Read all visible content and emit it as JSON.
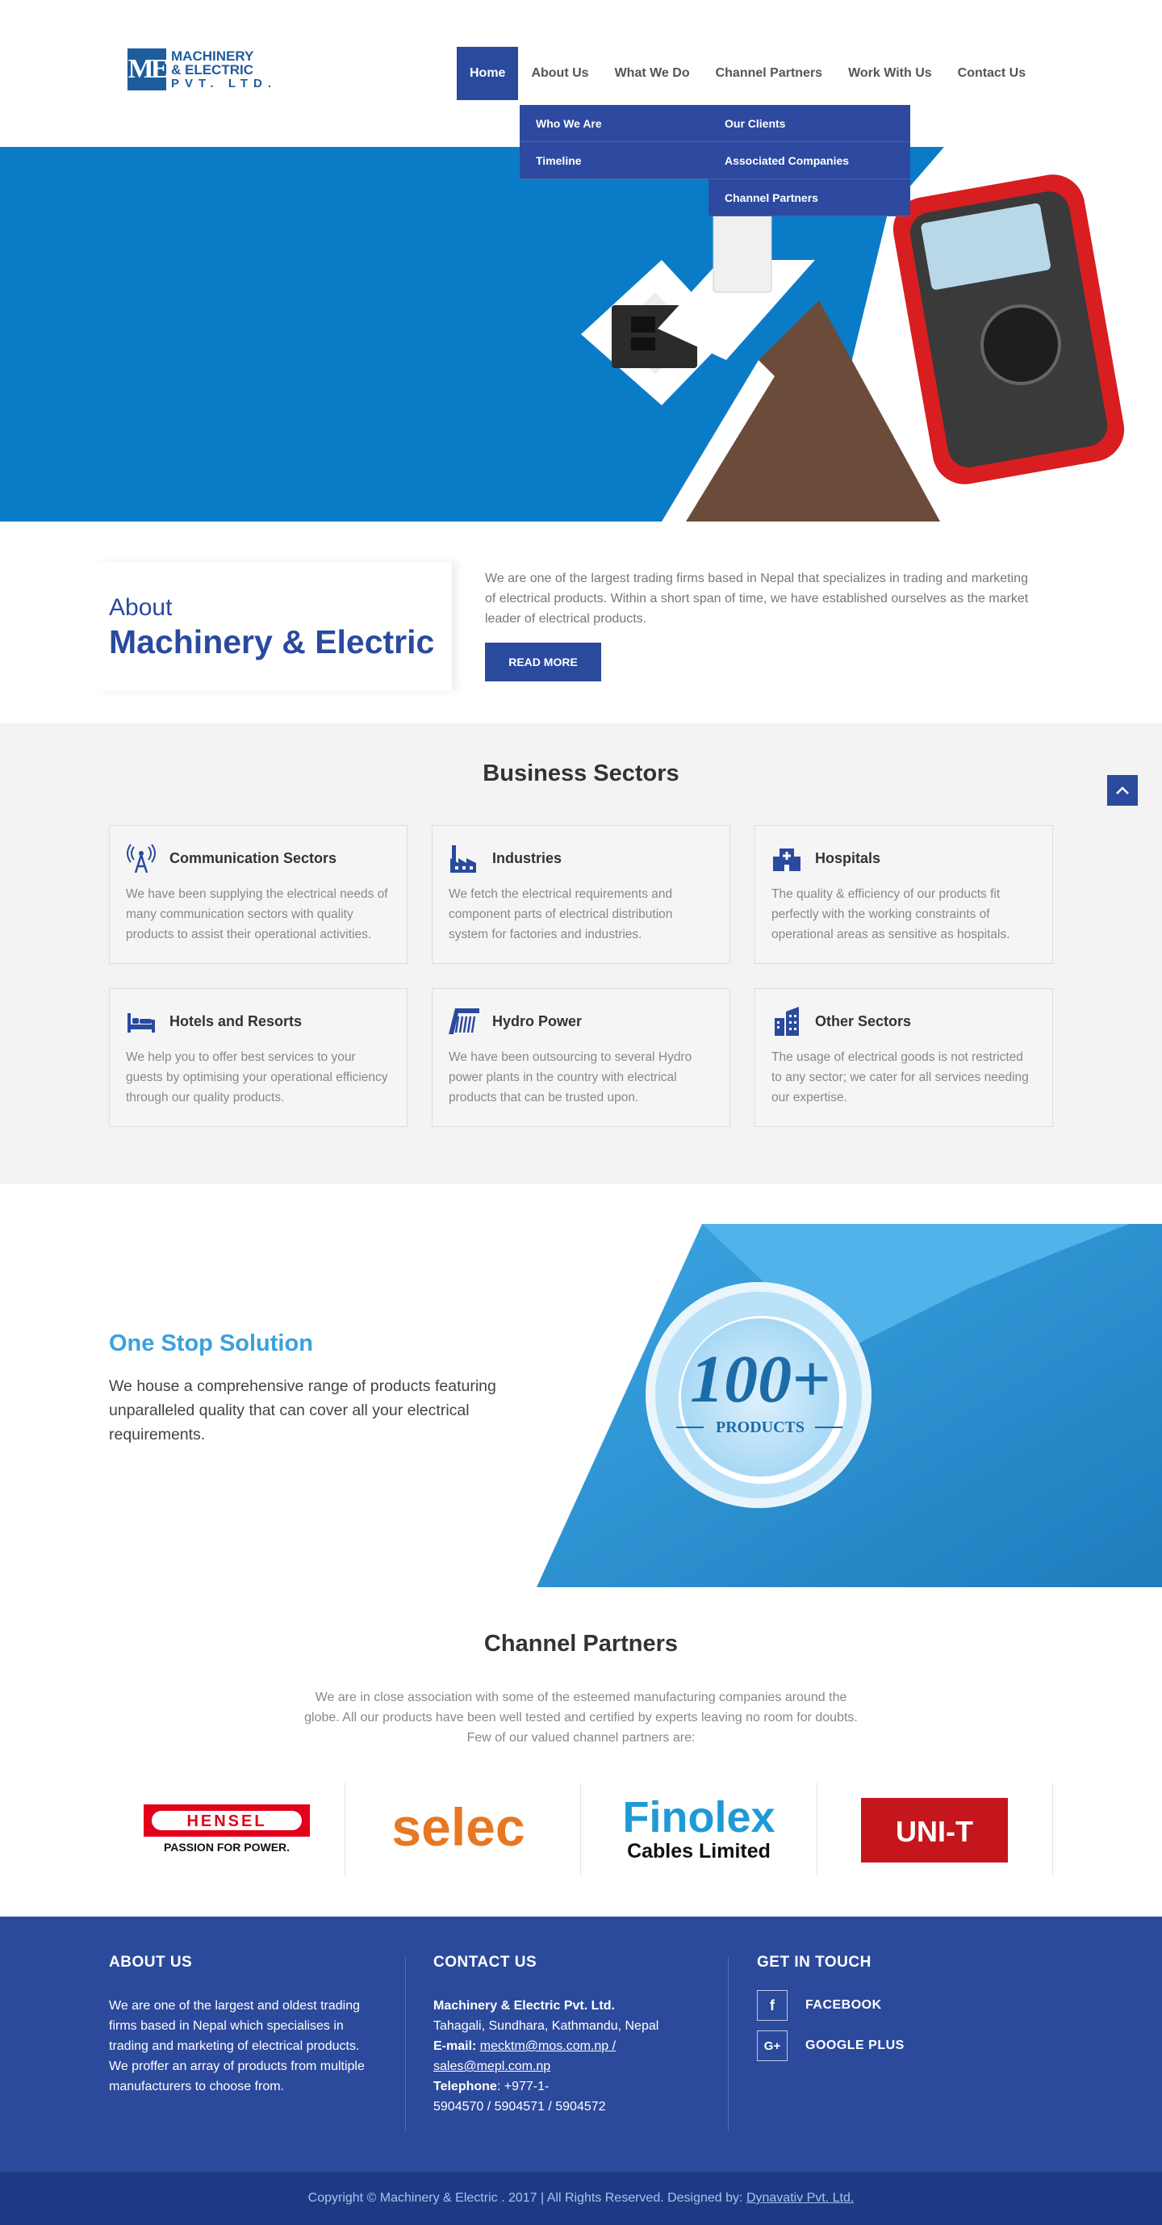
{
  "header": {
    "logo": {
      "mark": "ME",
      "line1": "MACHINERY",
      "line2": "& ELECTRIC",
      "line3": "PVT. LTD."
    },
    "nav": [
      "Home",
      "About Us",
      "What We Do",
      "Channel Partners",
      "Work With Us",
      "Contact Us"
    ],
    "about_menu": [
      "Who We Are",
      "Timeline"
    ],
    "channel_menu": [
      "Our Clients",
      "Associated Companies",
      "Channel Partners"
    ]
  },
  "about": {
    "small": "About",
    "big": "Machinery & Electric",
    "text": "We are one of the largest trading firms based in Nepal that specializes in trading and marketing of electrical products. Within a short span of time, we have established ourselves as the market leader of electrical products.",
    "button": "READ MORE"
  },
  "sectors": {
    "title": "Business Sectors",
    "items": [
      {
        "title": "Communication Sectors",
        "icon": "antenna-icon",
        "text": "We have been supplying the electrical needs of many communication sectors with quality products to assist their operational activities."
      },
      {
        "title": "Industries",
        "icon": "factory-icon",
        "text": "We fetch the electrical requirements and component parts of electrical distribution system for factories and industries."
      },
      {
        "title": "Hospitals",
        "icon": "hospital-icon",
        "text": "The quality & efficiency of our products fit perfectly with the working constraints of operational areas as sensitive as hospitals."
      },
      {
        "title": "Hotels and Resorts",
        "icon": "bed-icon",
        "text": "We help you to offer best services to your guests by optimising your operational efficiency through our quality products."
      },
      {
        "title": "Hydro Power",
        "icon": "dam-icon",
        "text": "We have been outsourcing to several Hydro power plants in the country with electrical products that can be trusted upon."
      },
      {
        "title": "Other Sectors",
        "icon": "building-icon",
        "text": "The usage of electrical goods is not restricted to any sector; we cater for all services needing our expertise."
      }
    ]
  },
  "onestop": {
    "title": "One Stop Solution",
    "text": "We house a comprehensive range of products featuring unparalleled quality that can cover all your electrical requirements.",
    "badge_number": "100+",
    "badge_label": "PRODUCTS"
  },
  "partners": {
    "title": "Channel Partners",
    "text": "We are in close association with some of the esteemed manufacturing companies around the globe. All our products have been well tested and certified by experts leaving no room for doubts. Few of our valued channel partners are:",
    "logos": [
      {
        "name": "HENSEL",
        "tagline": "PASSION FOR POWER."
      },
      {
        "name": "selec"
      },
      {
        "name": "Finolex",
        "tagline": "Cables Limited"
      },
      {
        "name": "UNI-T"
      }
    ]
  },
  "footer": {
    "about_title": "ABOUT US",
    "about_text": "We are one of the largest and oldest trading firms based in Nepal which specialises in trading and marketing of electrical products. We proffer an array of products from multiple manufacturers to choose from.",
    "contact_title": "CONTACT US",
    "company": "Machinery & Electric Pvt. Ltd.",
    "address": "Tahagali, Sundhara, Kathmandu, Nepal",
    "email_label": "E-mail:",
    "email_1": "mecktm@mos.com.np /",
    "email_2": "sales@mepl.com.np",
    "phone_label": "Telephone",
    "phone_1": ": +977-1-",
    "phone_2": "5904570 / 5904571 / 5904572",
    "touch_title": "GET IN TOUCH",
    "social": [
      {
        "label": "FACEBOOK",
        "glyph": "f"
      },
      {
        "label": "GOOGLE PLUS",
        "glyph": "G+"
      }
    ],
    "copyright_prefix": "Copyright © Machinery & Electric . 2017 | All Rights Reserved. Designed by:",
    "designer": "Dynavativ Pvt. Ltd."
  }
}
